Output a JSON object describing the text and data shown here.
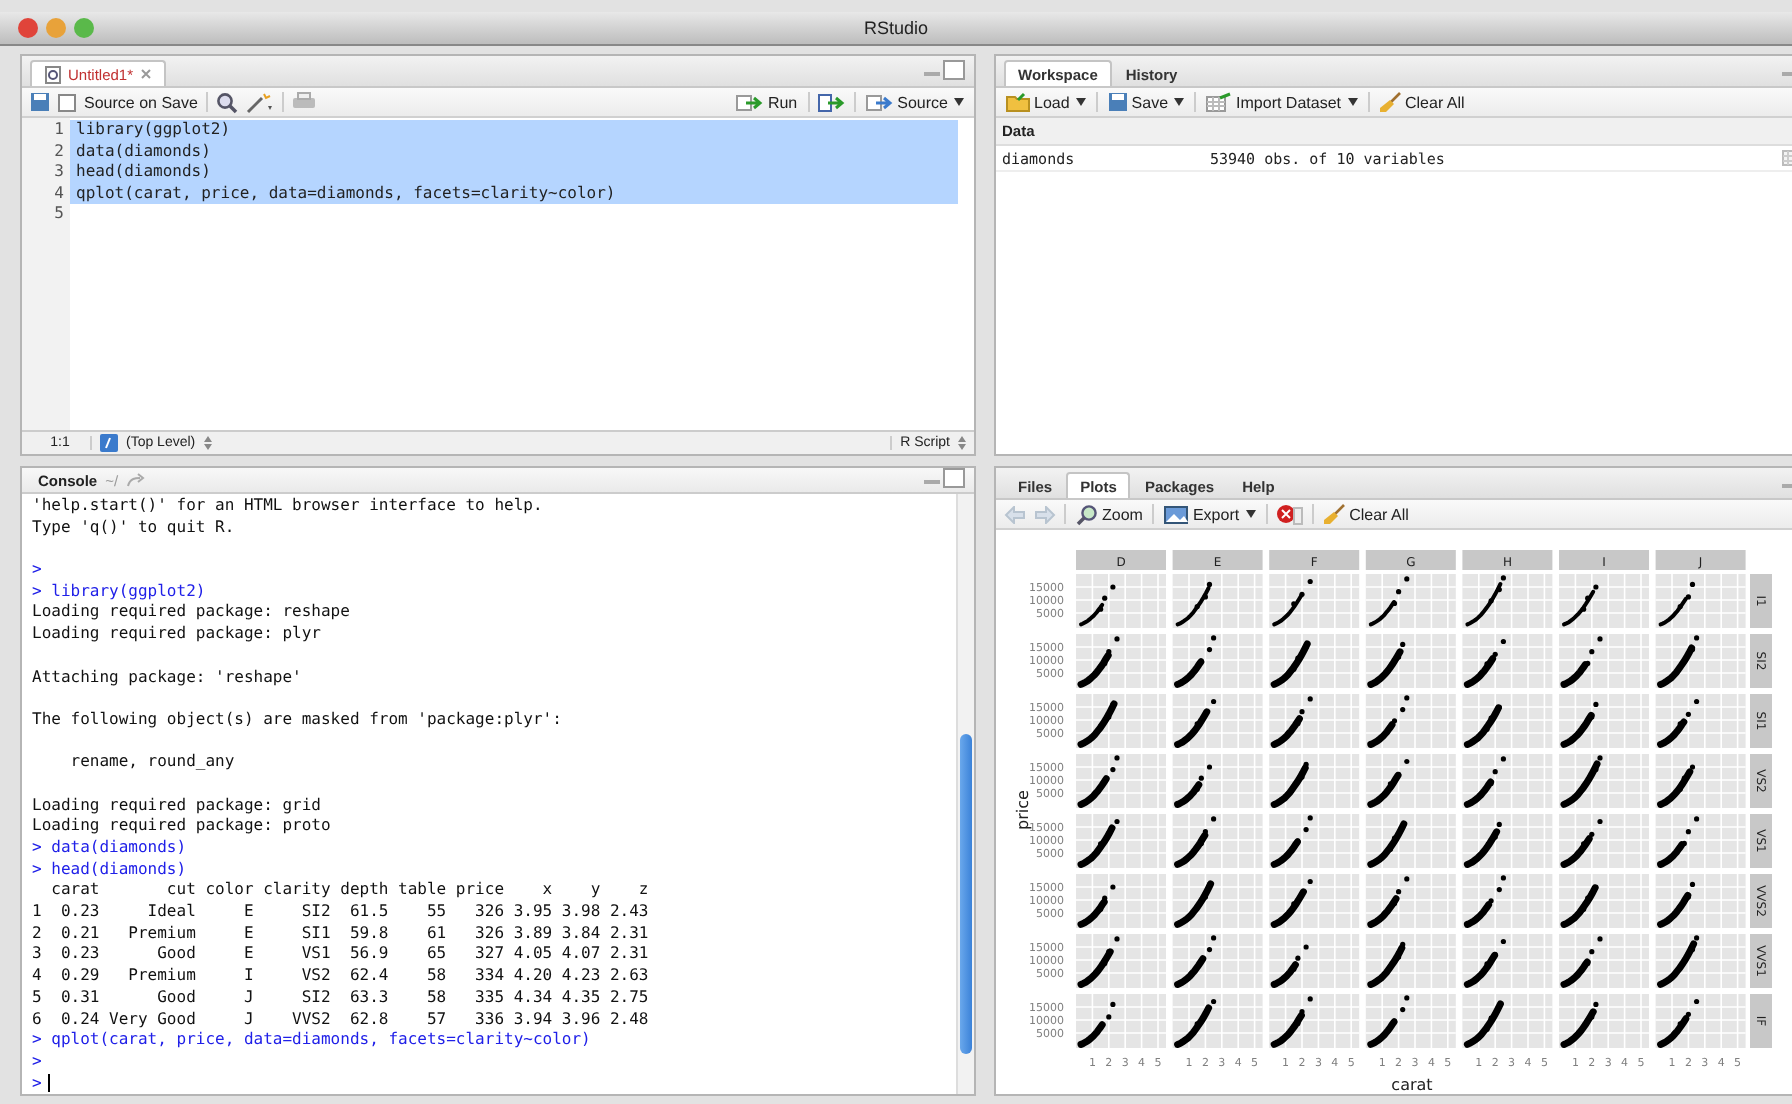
{
  "window": {
    "title": "RStudio"
  },
  "editor": {
    "tabs": [
      {
        "label": "Untitled1*",
        "selected": true
      }
    ],
    "toolbar": {
      "source_on_save": {
        "label": "Source on Save",
        "checked": false
      },
      "run": "Run",
      "source": "Source"
    },
    "lines": [
      {
        "number": "1",
        "code": "library(ggplot2)",
        "selected": true
      },
      {
        "number": "2",
        "code": "data(diamonds)",
        "selected": true
      },
      {
        "number": "3",
        "code": "head(diamonds)",
        "selected": true
      },
      {
        "number": "4",
        "code": "qplot(carat, price, data=diamonds, facets=clarity~color)",
        "selected": true
      },
      {
        "number": "5",
        "selected": false
      }
    ],
    "status": {
      "position": "1:1",
      "scope": "(Top Level)",
      "file_type": "R Script"
    }
  },
  "workspace": {
    "tabs": [
      {
        "label": "Workspace",
        "selected": true
      },
      {
        "label": "History",
        "selected": false
      }
    ],
    "toolbar": [
      {
        "kind": "load",
        "label": "Load",
        "dropdown": true
      },
      {
        "kind": "save",
        "label": "Save",
        "dropdown": true
      },
      {
        "kind": "import",
        "label": "Import Dataset",
        "dropdown": true
      },
      {
        "kind": "clear",
        "label": "Clear All",
        "dropdown": false
      }
    ],
    "section": "Data",
    "rows": [
      {
        "name": "diamonds",
        "value": "53940 obs. of 10 variables"
      }
    ]
  },
  "console": {
    "title": "Console",
    "path": "~/",
    "lines": [
      {
        "kind": "output",
        "text": "'help.start()' for an HTML browser interface to help."
      },
      {
        "kind": "output",
        "text": "Type 'q()' to quit R."
      },
      {
        "kind": "blank"
      },
      {
        "kind": "input",
        "text": ">"
      },
      {
        "kind": "input",
        "text": "> library(ggplot2)"
      },
      {
        "kind": "output",
        "text": "Loading required package: reshape"
      },
      {
        "kind": "output",
        "text": "Loading required package: plyr"
      },
      {
        "kind": "blank"
      },
      {
        "kind": "output",
        "text": "Attaching package: 'reshape'"
      },
      {
        "kind": "blank"
      },
      {
        "kind": "output",
        "text": "The following object(s) are masked from 'package:plyr':"
      },
      {
        "kind": "blank"
      },
      {
        "kind": "output",
        "text": "    rename, round_any"
      },
      {
        "kind": "blank"
      },
      {
        "kind": "output",
        "text": "Loading required package: grid"
      },
      {
        "kind": "output",
        "text": "Loading required package: proto"
      },
      {
        "kind": "input",
        "text": "> data(diamonds)"
      },
      {
        "kind": "input",
        "text": "> head(diamonds)"
      },
      {
        "kind": "output",
        "text": "  carat       cut color clarity depth table price    x    y    z"
      },
      {
        "kind": "output",
        "text": "1  0.23     Ideal     E     SI2  61.5    55   326 3.95 3.98 2.43"
      },
      {
        "kind": "output",
        "text": "2  0.21   Premium     E     SI1  59.8    61   326 3.89 3.84 2.31"
      },
      {
        "kind": "output",
        "text": "3  0.23      Good     E     VS1  56.9    65   327 4.05 4.07 2.31"
      },
      {
        "kind": "output",
        "text": "4  0.29   Premium     I     VS2  62.4    58   334 4.20 4.23 2.63"
      },
      {
        "kind": "output",
        "text": "5  0.31      Good     J     SI2  63.3    58   335 4.34 4.35 2.75"
      },
      {
        "kind": "output",
        "text": "6  0.24 Very Good     J    VVS2  62.8    57   336 3.94 3.96 2.48"
      },
      {
        "kind": "input",
        "text": "> qplot(carat, price, data=diamonds, facets=clarity~color)"
      },
      {
        "kind": "input",
        "text": ">"
      },
      {
        "kind": "cursor",
        "text": ">"
      }
    ]
  },
  "plots_pane": {
    "tabs": [
      {
        "label": "Files",
        "selected": false
      },
      {
        "label": "Plots",
        "selected": true
      },
      {
        "label": "Packages",
        "selected": false
      },
      {
        "label": "Help",
        "selected": false
      }
    ],
    "toolbar": [
      {
        "kind": "zoom",
        "label": "Zoom",
        "dropdown": false
      },
      {
        "kind": "export",
        "label": "Export",
        "dropdown": true
      },
      {
        "kind": "clear",
        "label": "Clear All",
        "dropdown": false
      }
    ],
    "plot": {
      "columns": [
        {
          "label": "D",
          "xticks": [
            "1",
            "2",
            "3",
            "4",
            "5"
          ]
        },
        {
          "label": "E",
          "xticks": [
            "1",
            "2",
            "3",
            "4",
            "5"
          ]
        },
        {
          "label": "F",
          "xticks": [
            "1",
            "2",
            "3",
            "4",
            "5"
          ]
        },
        {
          "label": "G",
          "xticks": [
            "1",
            "2",
            "3",
            "4",
            "5"
          ]
        },
        {
          "label": "H",
          "xticks": [
            "1",
            "2",
            "3",
            "4",
            "5"
          ]
        },
        {
          "label": "I",
          "xticks": [
            "1",
            "2",
            "3",
            "4",
            "5"
          ]
        },
        {
          "label": "J",
          "xticks": [
            "1",
            "2",
            "3",
            "4",
            "5"
          ]
        }
      ],
      "rows": [
        {
          "label": "I1",
          "yticks": [
            "15000",
            "10000",
            "5000"
          ]
        },
        {
          "label": "SI2",
          "yticks": [
            "15000",
            "10000",
            "5000"
          ]
        },
        {
          "label": "SI1",
          "yticks": [
            "15000",
            "10000",
            "5000"
          ]
        },
        {
          "label": "VS2",
          "yticks": [
            "15000",
            "10000",
            "5000"
          ]
        },
        {
          "label": "VS1",
          "yticks": [
            "15000",
            "10000",
            "5000"
          ]
        },
        {
          "label": "VVS2",
          "yticks": [
            "15000",
            "10000",
            "5000"
          ]
        },
        {
          "label": "VVS1",
          "yticks": [
            "15000",
            "10000",
            "5000"
          ]
        },
        {
          "label": "IF",
          "yticks": [
            "15000",
            "10000",
            "5000"
          ]
        }
      ],
      "xlabel": "carat",
      "ylabel": "price"
    }
  }
}
